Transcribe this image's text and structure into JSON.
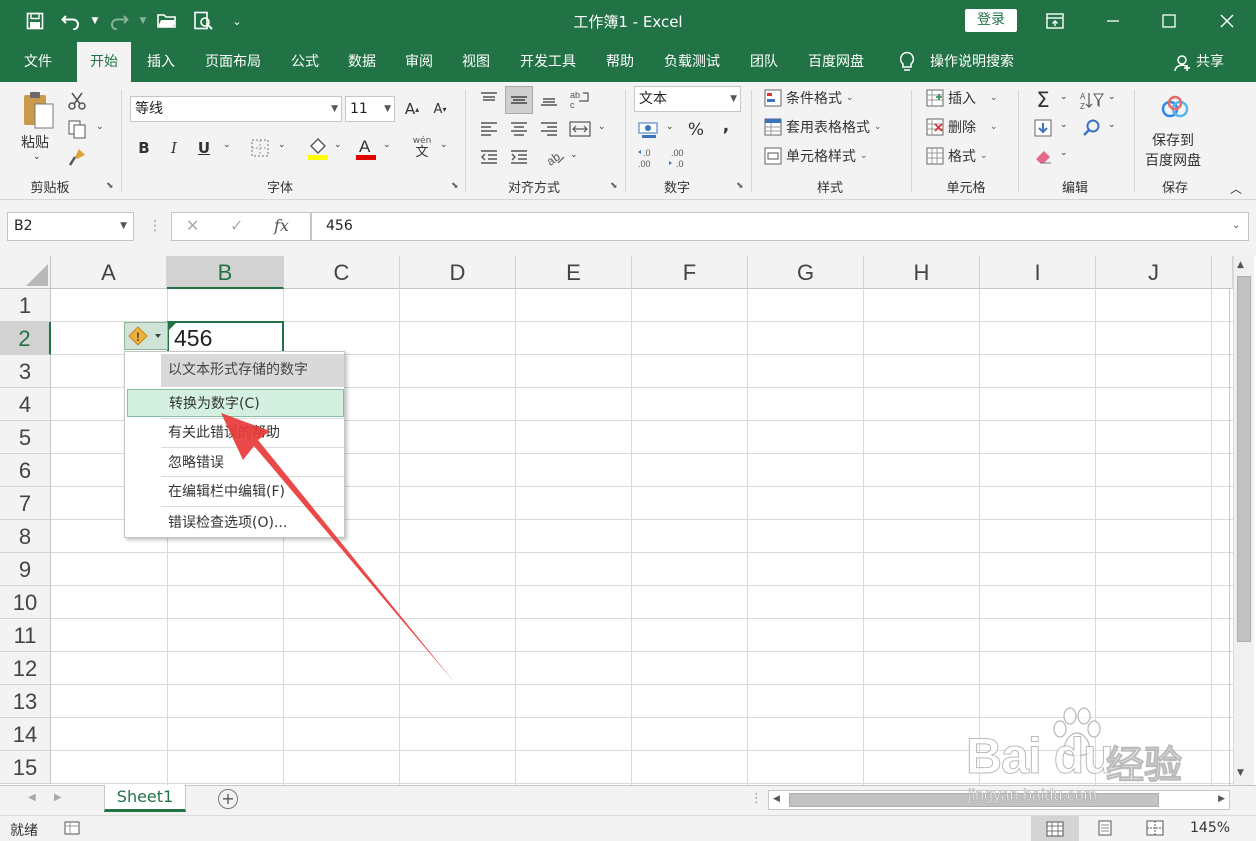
{
  "window": {
    "title": "工作簿1  -  Excel",
    "login_label": "登录"
  },
  "tabs": [
    {
      "label": "文件",
      "active": false
    },
    {
      "label": "开始",
      "active": true
    },
    {
      "label": "插入",
      "active": false
    },
    {
      "label": "页面布局",
      "active": false
    },
    {
      "label": "公式",
      "active": false
    },
    {
      "label": "数据",
      "active": false
    },
    {
      "label": "审阅",
      "active": false
    },
    {
      "label": "视图",
      "active": false
    },
    {
      "label": "开发工具",
      "active": false
    },
    {
      "label": "帮助",
      "active": false
    },
    {
      "label": "负载测试",
      "active": false
    },
    {
      "label": "团队",
      "active": false
    },
    {
      "label": "百度网盘",
      "active": false
    }
  ],
  "tell_me": "操作说明搜索",
  "share": "共享",
  "ribbon": {
    "clipboard": {
      "paste": "粘贴",
      "label": "剪贴板"
    },
    "font": {
      "name": "等线",
      "size": "11",
      "label": "字体",
      "bold": "B",
      "italic": "I",
      "underline": "U",
      "wen": "wén",
      "wen_char": "文"
    },
    "alignment": {
      "label": "对齐方式"
    },
    "number": {
      "format": "文本",
      "percent": "%",
      "comma": ",",
      "label": "数字"
    },
    "styles": {
      "conditional": "条件格式",
      "table": "套用表格格式",
      "cell": "单元格样式",
      "label": "样式"
    },
    "cells": {
      "insert": "插入",
      "delete": "删除",
      "format": "格式",
      "label": "单元格"
    },
    "editing": {
      "label": "编辑"
    },
    "save": {
      "line1": "保存到",
      "line2": "百度网盘",
      "label": "保存"
    }
  },
  "formula_bar": {
    "name_box": "B2",
    "fx": "fx",
    "content": "456"
  },
  "grid": {
    "columns": [
      "A",
      "B",
      "C",
      "D",
      "E",
      "F",
      "G",
      "H",
      "I",
      "J"
    ],
    "rows": [
      "1",
      "2",
      "3",
      "4",
      "5",
      "6",
      "7",
      "8",
      "9",
      "10",
      "11",
      "12",
      "13",
      "14",
      "15"
    ],
    "selected_column": "B",
    "selected_row": "2",
    "active_cell_value": "456"
  },
  "error_menu": {
    "header": "以文本形式存储的数字",
    "items": [
      {
        "label": "转换为数字(C)",
        "highlighted": true
      },
      {
        "label": "有关此错误的帮助",
        "highlighted": false
      },
      {
        "label": "忽略错误",
        "highlighted": false
      },
      {
        "label": "在编辑栏中编辑(F)",
        "highlighted": false
      },
      {
        "label": "错误检查选项(O)...",
        "highlighted": false
      }
    ]
  },
  "sheets": {
    "active": "Sheet1"
  },
  "status": {
    "mode": "就绪",
    "zoom": "145%"
  },
  "watermark": {
    "brand": "Bai du",
    "brand_cn": "经验",
    "url": "jingyan.baidu.com"
  },
  "colors": {
    "excel_green": "#217346",
    "arrow_red": "#e8393a"
  }
}
